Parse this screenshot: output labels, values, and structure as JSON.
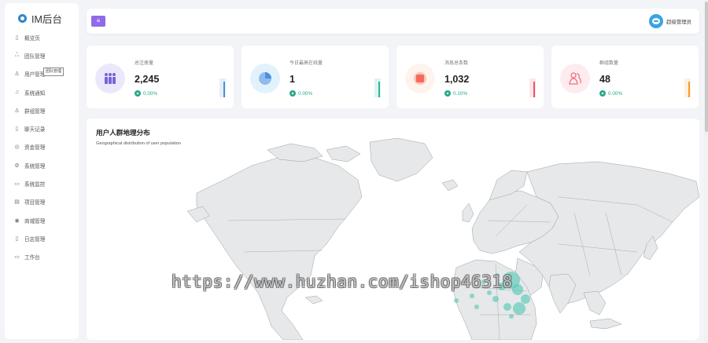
{
  "brand": {
    "name": "IM后台"
  },
  "sidebar": {
    "items": [
      {
        "label": "概览页",
        "icon": "document-icon",
        "glyph": "▯"
      },
      {
        "label": "团队管理",
        "icon": "team-icon",
        "glyph": "ஃ"
      },
      {
        "label": "用户管理",
        "icon": "user-icon",
        "glyph": "♙",
        "tooltip": "团队管理"
      },
      {
        "label": "系统通知",
        "icon": "bell-icon",
        "glyph": "♫"
      },
      {
        "label": "群组管理",
        "icon": "group-icon",
        "glyph": "♙"
      },
      {
        "label": "聊天记录",
        "icon": "chat-record-icon",
        "glyph": "▯"
      },
      {
        "label": "资金管理",
        "icon": "money-icon",
        "glyph": "◎"
      },
      {
        "label": "系统管理",
        "icon": "settings-icon",
        "glyph": "⚙"
      },
      {
        "label": "系统监控",
        "icon": "monitor-icon",
        "glyph": "▭"
      },
      {
        "label": "项目管理",
        "icon": "project-icon",
        "glyph": "▤"
      },
      {
        "label": "商城管理",
        "icon": "shop-icon",
        "glyph": "◉"
      },
      {
        "label": "日志管理",
        "icon": "log-icon",
        "glyph": "▯"
      },
      {
        "label": "工作台",
        "icon": "desktop-icon",
        "glyph": "▭"
      }
    ]
  },
  "header": {
    "toggle_glyph": "≡",
    "user_name": "超级管理员"
  },
  "stats": [
    {
      "label": "总注册量",
      "value": "2,245",
      "change": "0.00%",
      "icon": "users-icon",
      "icon_color": "#7b61d9",
      "icon_bg": "#ece8fb",
      "spark_color": "#4a8fe0"
    },
    {
      "label": "今日最高在线量",
      "value": "1",
      "change": "0.00%",
      "icon": "pie-chart-icon",
      "icon_color": "#4a8fe0",
      "icon_bg": "#e2f2fc",
      "spark_color": "#2bb59a"
    },
    {
      "label": "消息总条数",
      "value": "1,032",
      "change": "0.10%",
      "icon": "message-icon",
      "icon_color": "#f36b5a",
      "icon_bg": "#fff3ee",
      "spark_color": "#e8546a"
    },
    {
      "label": "群组数量",
      "value": "48",
      "change": "0.00%",
      "icon": "group-icon",
      "icon_color": "#f07080",
      "icon_bg": "#fdecef",
      "spark_color": "#f59b2a"
    }
  ],
  "map": {
    "title": "用户人群地理分布",
    "subtitle": "Geographical distribution of user population",
    "land_color": "#e6e8e9",
    "border_color": "#9aa0a4",
    "bubble_color": "#4ec6b6"
  },
  "watermark": "https://www.huzhan.com/ishop46318"
}
